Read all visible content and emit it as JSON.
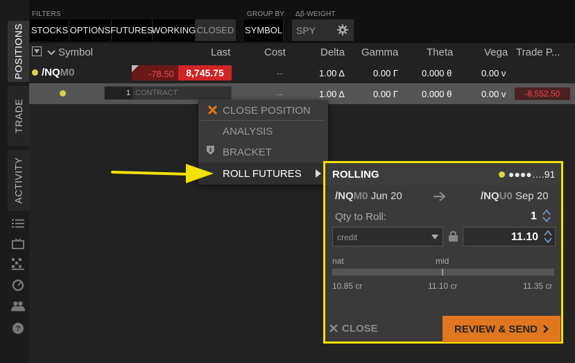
{
  "tabs": {
    "positions": "POSITIONS",
    "trade": "TRADE",
    "activity": "ACTIVITY"
  },
  "filters": {
    "label": "FILTERS",
    "buttons": [
      "STOCKS",
      "OPTIONS",
      "FUTURES",
      "WORKING",
      "CLOSED"
    ],
    "group_by_label": "GROUP BY",
    "group_by_value": "SYMBOL",
    "weight_label": "Δβ-WEIGHT",
    "weight_value": "SPY"
  },
  "columns": {
    "symbol": "Symbol",
    "last": "Last",
    "cost": "Cost",
    "delta": "Delta",
    "gamma": "Gamma",
    "theta": "Theta",
    "vega": "Vega",
    "trade_pl": "Trade P..."
  },
  "position": {
    "root": "/NQ",
    "month": "M0",
    "change": "-78.50",
    "last": "8,745.75",
    "cost": "--",
    "delta": "1.00 Δ",
    "gamma": "0.00 Γ",
    "theta": "0.000 θ",
    "vega": "0.00 ν"
  },
  "subrow": {
    "qty": "1",
    "unit": "CONTRACT",
    "cost": "--",
    "delta": "1.00 Δ",
    "gamma": "0.00 Γ",
    "theta": "0.000 θ",
    "vega": "0.00 ν",
    "trade_pl": "-8,552.50"
  },
  "context_menu": {
    "close": "CLOSE POSITION",
    "analysis": "ANALYSIS",
    "bracket": "BRACKET",
    "roll": "ROLL FUTURES"
  },
  "rolling": {
    "title": "ROLLING",
    "account": "●●●●….91",
    "from_root": "/NQ",
    "from_month": "M0",
    "from_date": "Jun 20",
    "to_root": "/NQ",
    "to_month": "U0",
    "to_date": "Sep 20",
    "qty_label": "Qty to Roll:",
    "qty": "1",
    "price_type": "credit",
    "price": "11.10",
    "nat_label": "nat",
    "mid_label": "mid",
    "low": "10.85 cr",
    "mid": "11.10 cr",
    "high": "11.35 cr",
    "close": "CLOSE",
    "review": "REVIEW & SEND"
  },
  "colors": {
    "highlight": "#f2e200",
    "accent": "#e0761e",
    "negative": "#e03030",
    "status_dot": "#d8d34a"
  }
}
